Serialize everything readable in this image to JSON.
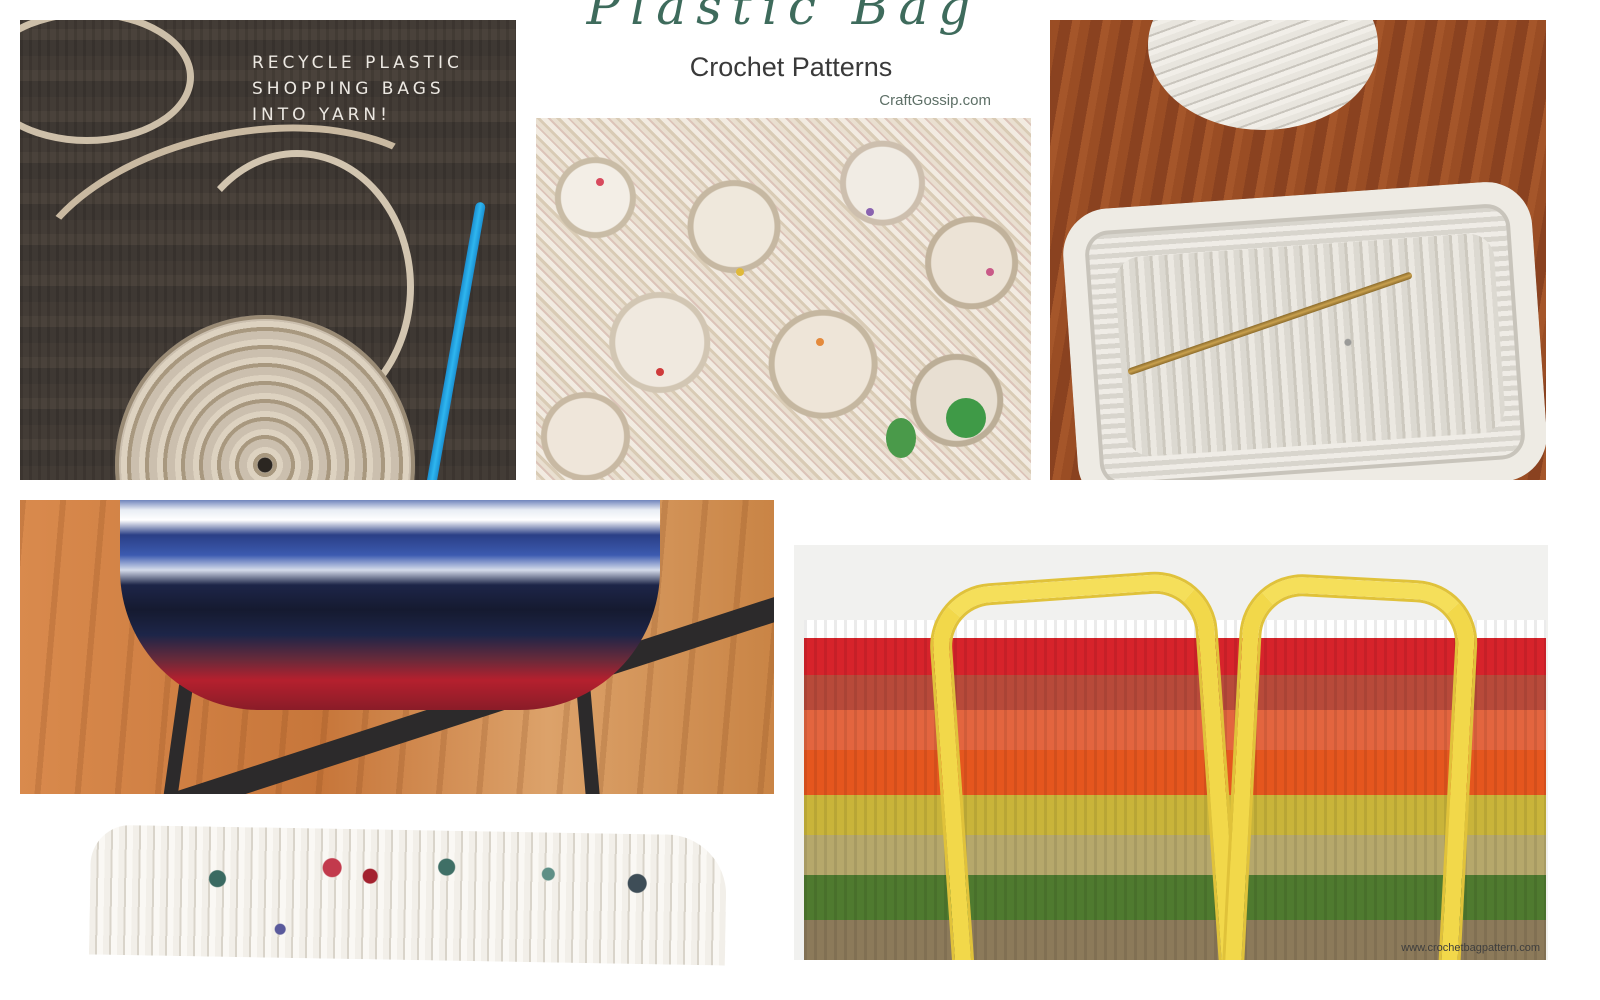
{
  "collage": {
    "tile1": {
      "caption_lines": [
        "RECYCLE PLASTIC",
        "SHOPPING BAGS",
        "INTO YARN!"
      ]
    },
    "tile2": {
      "script_title": "Plastic Bag",
      "subtitle": "Crochet Patterns",
      "site": "CraftGossip.com"
    },
    "tile6": {
      "watermark": "www.crochetbagpattern.com"
    }
  }
}
